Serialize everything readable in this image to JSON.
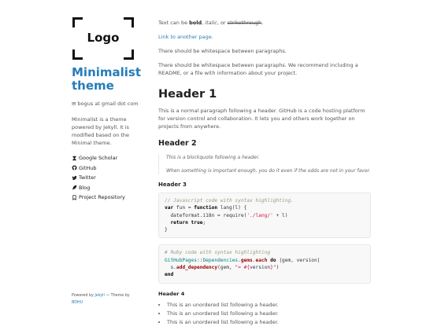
{
  "sidebar": {
    "logo_text": "Logo",
    "site_title": "Minimalist theme",
    "email": "✉ bogus at gmail dot com",
    "description": "Minimalist is a theme powered by Jekyll. It is modified based on the Minimal theme.",
    "nav": [
      {
        "label": "Google Scholar",
        "icon": "hourglass-icon"
      },
      {
        "label": "GitHub",
        "icon": "github-icon"
      },
      {
        "label": "Twitter",
        "icon": "twitter-icon"
      },
      {
        "label": "Blog",
        "icon": "feather-icon"
      },
      {
        "label": "Project Repository",
        "icon": "bookmark-icon"
      }
    ],
    "powered_prefix": "Powered by",
    "powered_jekyll": "Jekyll",
    "powered_middle": " — Theme by",
    "powered_theme": "BDHU"
  },
  "main": {
    "intro": {
      "prefix": "Text can be ",
      "bold": "bold",
      "sep1": ", ",
      "italic": "italic",
      "sep2": ", or ",
      "strike": "strikethrough",
      "suffix": "."
    },
    "link_text": "Link to another page",
    "link_suffix": ".",
    "para1": "There should be whitespace between paragraphs.",
    "para2": "There should be whitespace between paragraphs. We recommend including a README, or a file with information about your project.",
    "h1": "Header 1",
    "para3": "This is a normal paragraph following a header. GitHub is a code hosting platform for version control and collaboration. It lets you and others work together on projects from anywhere.",
    "h2": "Header 2",
    "quote1": "This is a blockquote following a header.",
    "quote2": "When something is important enough, you do it even if the odds are not in your favor.",
    "h3": "Header 3",
    "js": {
      "comment": "// Javascript code with syntax highlighting.",
      "l2a": "var",
      "l2b": " fun = ",
      "l2c": "function",
      "l2d": " lang(l) {",
      "l3a": "  dateformat.i18n = require(",
      "l3b": "'./lang/'",
      "l3c": " + l)",
      "l4a": "  ",
      "l4b": "return",
      "l4c": " ",
      "l4d": "true",
      "l4e": ";",
      "l5": "}"
    },
    "ruby": {
      "comment": "# Ruby code with syntax highlighting",
      "l2a": "GitHubPages",
      "l2b": "::",
      "l2c": "Dependencies",
      "l2d": ".",
      "l2e": "gems",
      "l2f": ".",
      "l2g": "each",
      "l2h": " ",
      "l2i": "do",
      "l2j": " |gem, version|",
      "l3a": "  s.",
      "l3b": "add_dependency",
      "l3c": "(gem, ",
      "l3d": "\"= #{",
      "l3e": "version",
      "l3f": "}\"",
      "l3g": ")",
      "l4": "end"
    },
    "h4": "Header 4",
    "list": [
      "This is an unordered list following a header.",
      "This is an unordered list following a header.",
      "This is an unordered list following a header."
    ]
  },
  "colors": {
    "accent": "#267CB9",
    "heading": "#222222",
    "text": "#555555"
  }
}
